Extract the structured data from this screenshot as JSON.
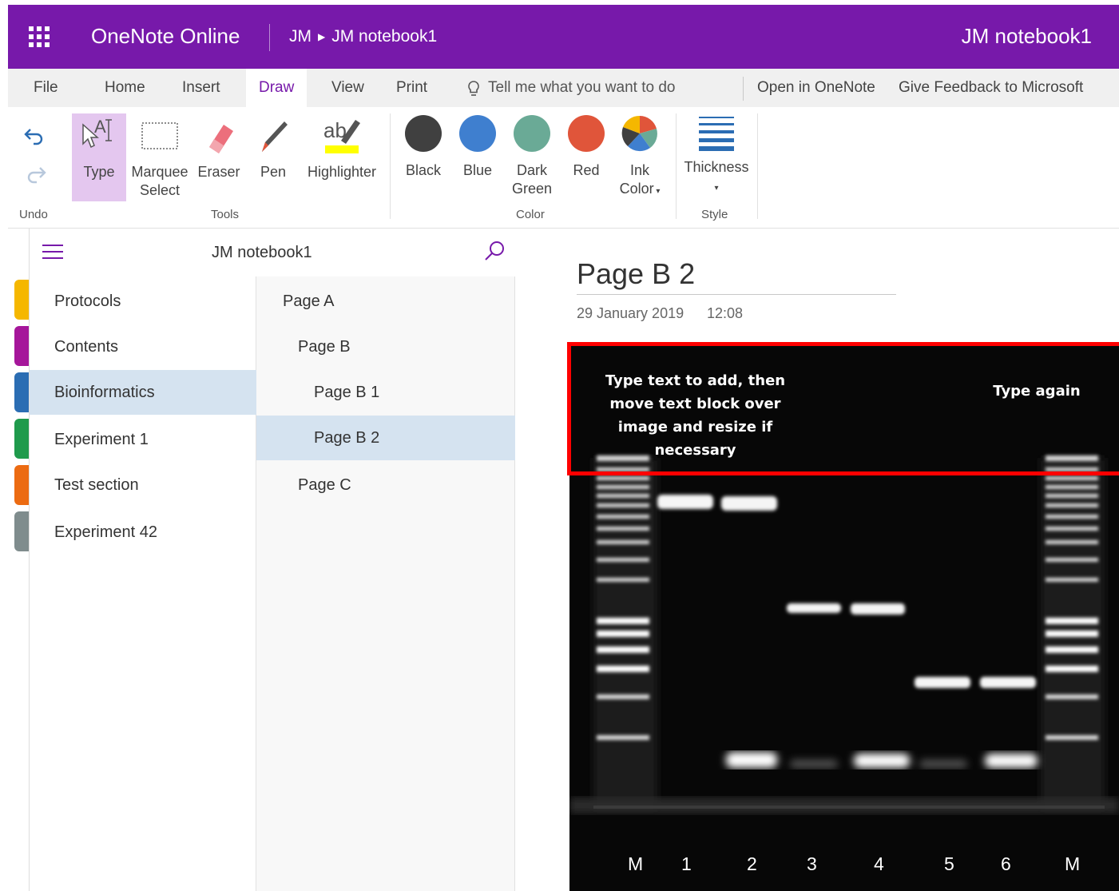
{
  "titlebar": {
    "app_name": "OneNote Online",
    "breadcrumb_user": "JM",
    "breadcrumb_notebook": "JM notebook1",
    "notebook_title": "JM notebook1",
    "bg_color": "#7719aa"
  },
  "tabs": {
    "items": [
      "File",
      "Home",
      "Insert",
      "Draw",
      "View",
      "Print"
    ],
    "active": "Draw",
    "tell_me": "Tell me what you want to do",
    "open_in_onenote": "Open in OneNote",
    "give_feedback": "Give Feedback to Microsoft"
  },
  "ribbon": {
    "undo_label": "Undo",
    "tools": {
      "type": "Type",
      "marquee_line1": "Marquee",
      "marquee_line2": "Select",
      "eraser": "Eraser",
      "pen": "Pen",
      "highlighter": "Highlighter",
      "group_label": "Tools"
    },
    "colors": {
      "black": "Black",
      "blue": "Blue",
      "dark_green_line1": "Dark",
      "dark_green_line2": "Green",
      "red": "Red",
      "ink_line1": "Ink",
      "ink_line2": "Color",
      "group_label": "Color",
      "swatch_black": "#404040",
      "swatch_blue": "#3f7fcf",
      "swatch_dark_green": "#6aaa96",
      "swatch_red": "#e0553a"
    },
    "style": {
      "thickness": "Thickness",
      "group_label": "Style"
    }
  },
  "nav": {
    "notebook_name": "JM notebook1",
    "sections": [
      {
        "label": "Protocols",
        "color": "#f5b700"
      },
      {
        "label": "Contents",
        "color": "#a5169a"
      },
      {
        "label": "Bioinformatics",
        "color": "#2b6db3"
      },
      {
        "label": "Experiment 1",
        "color": "#1f9a4c"
      },
      {
        "label": "Test section",
        "color": "#ec6b12"
      },
      {
        "label": "Experiment 42",
        "color": "#7f8c8d"
      }
    ],
    "selected_section": "Bioinformatics",
    "pages": [
      {
        "label": "Page A",
        "level": 0
      },
      {
        "label": "Page B",
        "level": 1
      },
      {
        "label": "Page B 1",
        "level": 2
      },
      {
        "label": "Page B 2",
        "level": 2
      },
      {
        "label": "Page C",
        "level": 1
      }
    ],
    "selected_page": "Page B 2"
  },
  "page": {
    "title": "Page B 2",
    "date": "29 January 2019",
    "time": "12:08"
  },
  "gel": {
    "text_block_1": "Type text to add, then move text block over image and resize if necessary",
    "text_block_2": "Type again",
    "lanes": [
      "M",
      "1",
      "2",
      "3",
      "4",
      "5",
      "6",
      "M"
    ]
  }
}
